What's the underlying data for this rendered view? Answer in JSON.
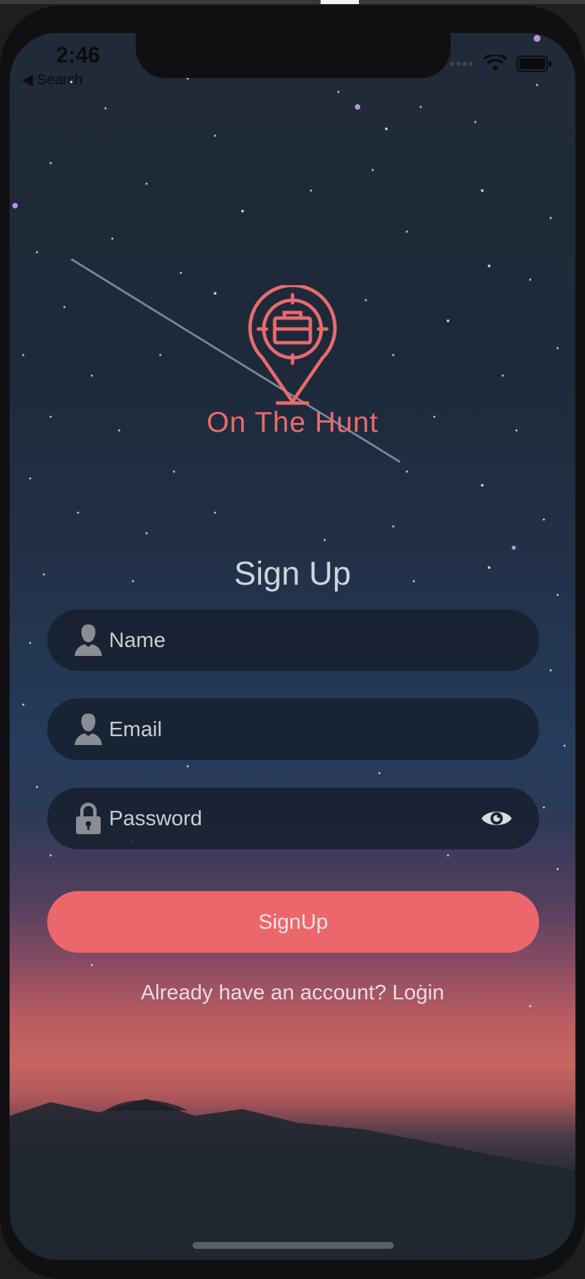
{
  "status_bar": {
    "time": "2:46",
    "back_label": "◀ Search"
  },
  "app": {
    "name": "On The Hunt",
    "logo_icon": "location-pin-target-briefcase-icon",
    "accent_color": "#ec676b"
  },
  "form": {
    "heading": "Sign Up",
    "name": {
      "placeholder": "Name",
      "value": "",
      "icon": "person-icon"
    },
    "email": {
      "placeholder": "Email",
      "value": "",
      "icon": "person-icon"
    },
    "password": {
      "placeholder": "Password",
      "value": "",
      "icon": "lock-icon",
      "toggle_icon": "eye-icon"
    },
    "submit_label": "SignUp",
    "login_prompt": "Already have an account? Login"
  }
}
